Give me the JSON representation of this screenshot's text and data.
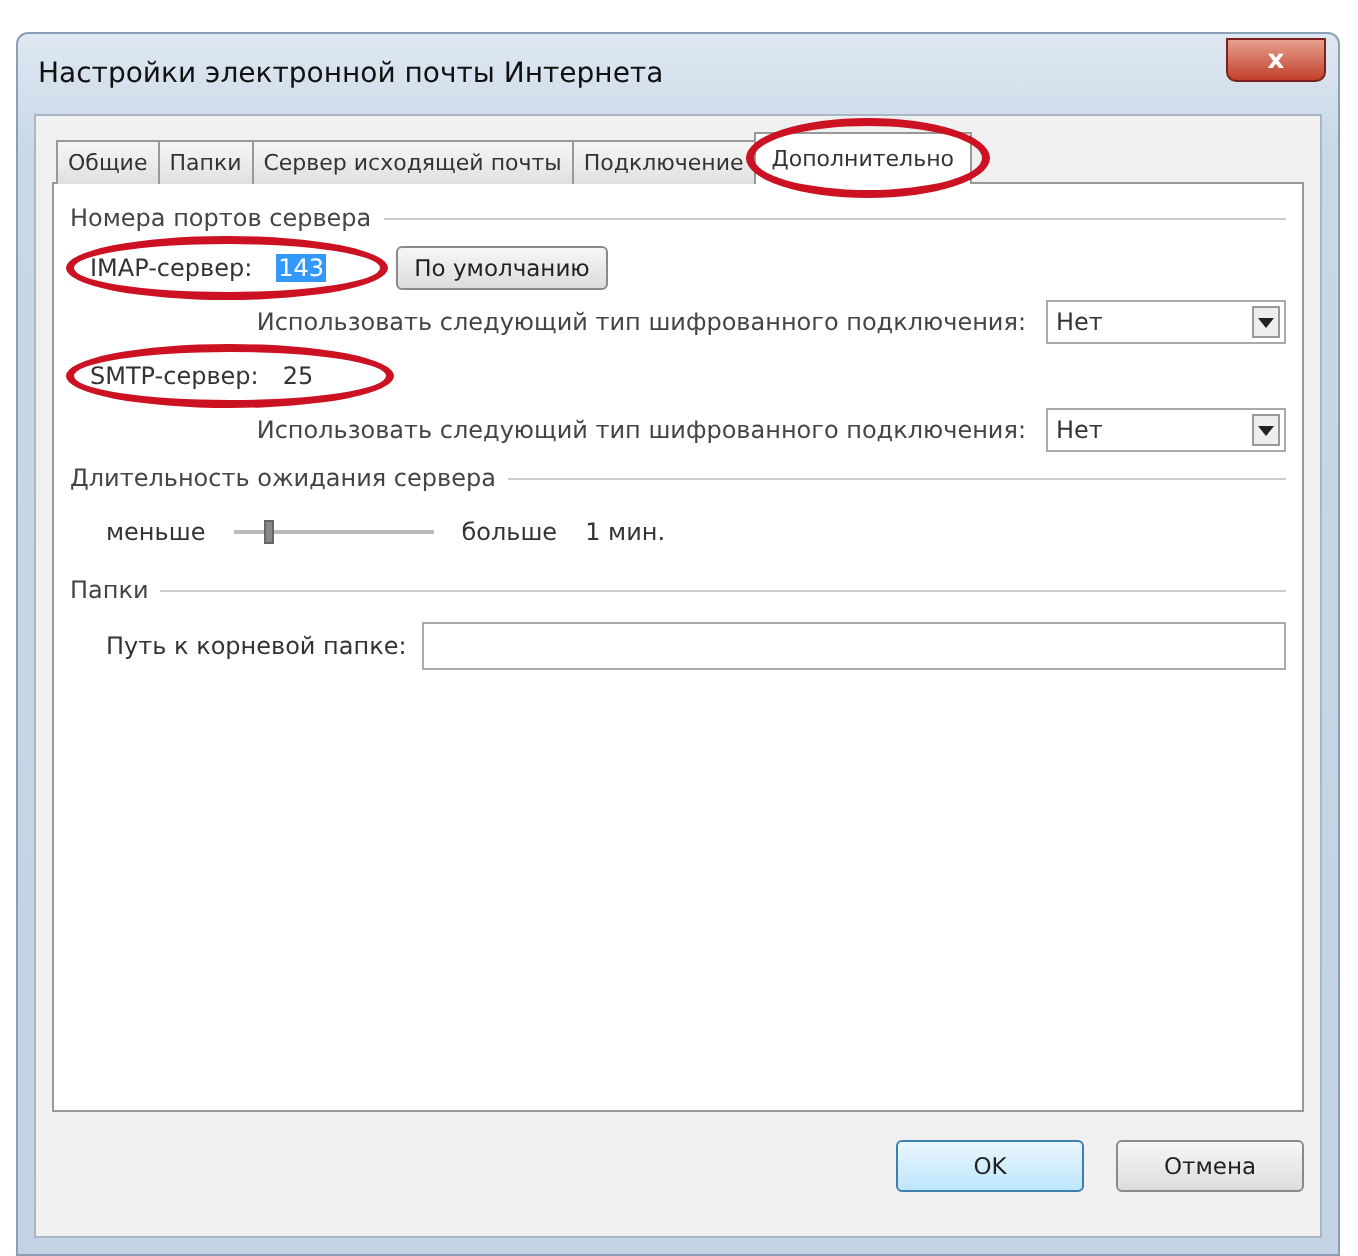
{
  "window": {
    "title": "Настройки электронной почты Интернета",
    "close": "x"
  },
  "tabs": [
    {
      "label": "Общие",
      "selected": false,
      "circled": false
    },
    {
      "label": "Папки",
      "selected": false,
      "circled": false
    },
    {
      "label": "Сервер исходящей почты",
      "selected": false,
      "circled": false
    },
    {
      "label": "Подключение",
      "selected": false,
      "circled": false
    },
    {
      "label": "Дополнительно",
      "selected": true,
      "circled": true
    }
  ],
  "ports": {
    "legend": "Номера портов сервера",
    "imap": {
      "label": "IMAP-сервер:",
      "value": "143",
      "value_selected": true,
      "circled": true,
      "default_button": "По умолчанию",
      "encryption_label": "Использовать следующий тип шифрованного подключения:",
      "encryption": "Нет"
    },
    "smtp": {
      "label": "SMTP-сервер:",
      "value": "25",
      "value_selected": false,
      "circled": true,
      "encryption_label": "Использовать следующий тип шифрованного подключения:",
      "encryption": "Нет"
    }
  },
  "timeout": {
    "legend": "Длительность ожидания сервера",
    "min_label": "меньше",
    "max_label": "больше",
    "level": 0.15,
    "reading": "1 мин."
  },
  "folders": {
    "legend": "Папки",
    "root_label": "Путь к корневой папке:"
  },
  "buttons": [
    {
      "label": "OK",
      "default": true
    },
    {
      "label": "Отмена",
      "default": false
    }
  ]
}
